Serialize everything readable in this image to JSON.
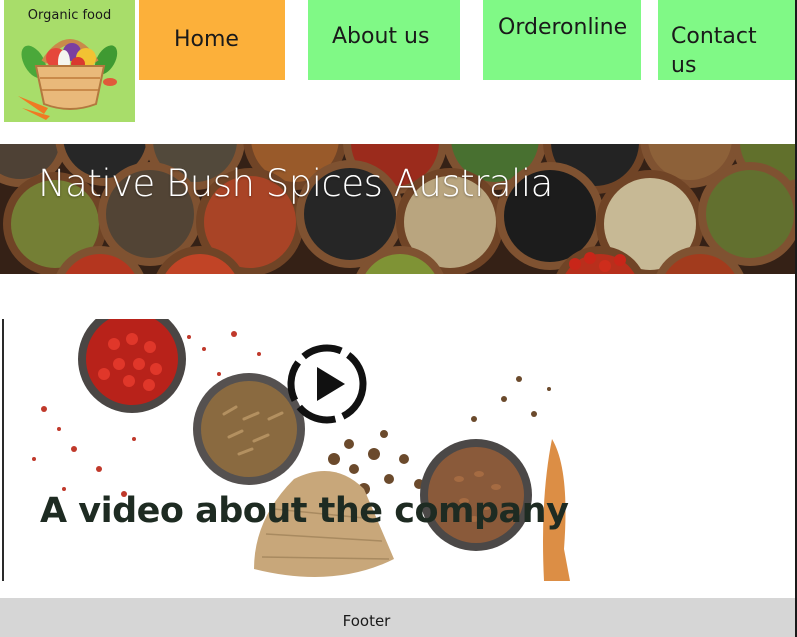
{
  "logo": {
    "text": "Organic food",
    "icon": "vegetable-basket-icon"
  },
  "nav": {
    "home": "Home",
    "about": "About us",
    "order": "Orderonline",
    "contact": "Contact us"
  },
  "hero": {
    "title": "Native Bush Spices Australia"
  },
  "video": {
    "title": "A video about the company",
    "play_icon": "play-icon"
  },
  "footer": {
    "text": "Footer"
  },
  "colors": {
    "logo_bg": "#a8dd6a",
    "home_bg": "#fcb03a",
    "nav_bg": "#80f986",
    "footer_bg": "#d6d6d6"
  }
}
